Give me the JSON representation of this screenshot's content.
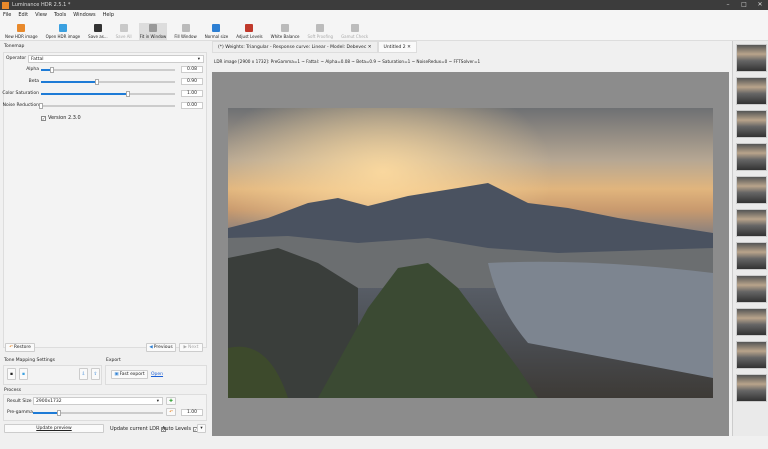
{
  "window": {
    "title": "Luminance HDR 2.5.1 *"
  },
  "menu": [
    "File",
    "Edit",
    "View",
    "Tools",
    "Windows",
    "Help"
  ],
  "toolbar": [
    {
      "label": "New HDR image",
      "icon": "new-hdr-icon",
      "state": "enabled",
      "color": "#e8892b"
    },
    {
      "label": "Open HDR image",
      "icon": "open-hdr-icon",
      "state": "enabled",
      "color": "#3aa0e0"
    },
    {
      "label": "Save as...",
      "icon": "save-icon",
      "state": "enabled",
      "color": "#333333"
    },
    {
      "label": "Save All",
      "icon": "save-all-icon",
      "state": "disabled",
      "color": "#888888"
    },
    {
      "label": "Fit in Window",
      "icon": "fit-window-icon",
      "state": "active",
      "color": "#999999"
    },
    {
      "label": "Fill Window",
      "icon": "fill-window-icon",
      "state": "enabled",
      "color": "#bbbbbb"
    },
    {
      "label": "Normal size",
      "icon": "zoom-icon",
      "state": "enabled",
      "color": "#2d7fd3"
    },
    {
      "label": "Adjust Levels",
      "icon": "levels-icon",
      "state": "enabled",
      "color": "#c0392b"
    },
    {
      "label": "White Balance",
      "icon": "white-balance-icon",
      "state": "enabled",
      "color": "#bbbbbb"
    },
    {
      "label": "Soft Proofing",
      "icon": "printer-icon",
      "state": "disabled",
      "color": "#666666"
    },
    {
      "label": "Gamut Check",
      "icon": "gamut-icon",
      "state": "disabled",
      "color": "#666666"
    }
  ],
  "tonemap": {
    "title": "Tonemap",
    "operator_label": "Operator",
    "operator": "Fattal",
    "sliders": [
      {
        "label": "Alpha",
        "value": "0.08",
        "fraction": 0.08
      },
      {
        "label": "Beta",
        "value": "0.90",
        "fraction": 0.42
      },
      {
        "label": "Color Saturation",
        "value": "1.00",
        "fraction": 0.65
      },
      {
        "label": "Noise Reduction",
        "value": "0.00",
        "fraction": 0.0
      }
    ],
    "version_label": "Version 2.3.0",
    "version_checked": true,
    "restore": "Restore",
    "previous": "Previous",
    "next": "Next"
  },
  "settings": {
    "title": "Tone Mapping Settings"
  },
  "export": {
    "title": "Export",
    "fast_export": "Fast export",
    "open": "Open"
  },
  "process": {
    "title": "Process",
    "result_size_label": "Result Size",
    "result_size": "2900x1732",
    "pregamma_label": "Pre-gamma",
    "pregamma": "1.00",
    "pregamma_fraction": 0.2,
    "update_preview": "Update preview",
    "update_ldr": "Update current LDR",
    "update_ldr_checked": true,
    "auto_levels": "Auto Levels",
    "auto_levels_checked": true
  },
  "tabs": [
    {
      "label": "(*) Weights: Triangular - Response curve: Linear - Model: Debevec",
      "active": false
    },
    {
      "label": "Untitled 2",
      "active": true
    }
  ],
  "info": "LDR image [2900 x 1732]: PreGamma=1 ~ Fattal: ~ Alpha=0.08 ~ Beta=0.9 ~ Saturation=1 ~ NoiseRedux=0 ~ FFTSolver=1"
}
